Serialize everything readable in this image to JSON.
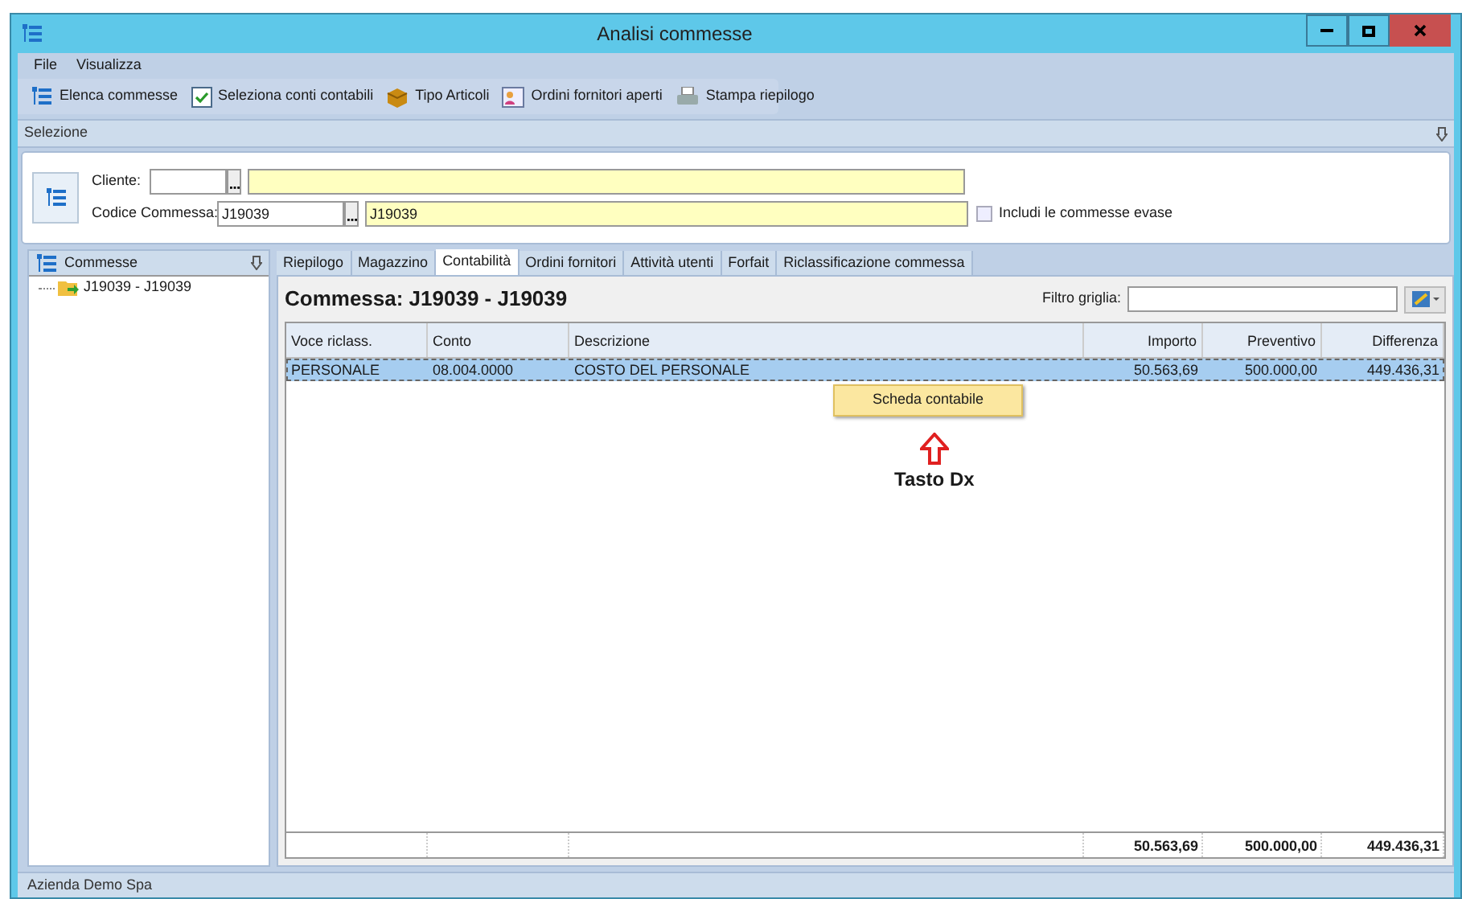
{
  "window": {
    "title": "Analisi commesse"
  },
  "menu": [
    "File",
    "Visualizza"
  ],
  "toolbar": [
    {
      "label": "Elenca commesse",
      "kind": "list"
    },
    {
      "label": "Seleziona conti contabili",
      "kind": "check"
    },
    {
      "label": "Tipo Articoli",
      "kind": "box"
    },
    {
      "label": "Ordini fornitori aperti",
      "kind": "person"
    },
    {
      "label": "Stampa riepilogo",
      "kind": "printer"
    }
  ],
  "selection": {
    "title": "Selezione",
    "cliente_label": "Cliente:",
    "codice_label": "Codice Commessa:",
    "codice_value": "J19039",
    "codice_desc": "J19039",
    "include_label": "Includi le commesse evase",
    "include_checked": false
  },
  "tree": {
    "title": "Commesse",
    "items": [
      {
        "label": "J19039 - J19039"
      }
    ]
  },
  "tabs": [
    {
      "label": "Riepilogo",
      "selected": false
    },
    {
      "label": "Magazzino",
      "selected": false
    },
    {
      "label": "Contabilità",
      "selected": true
    },
    {
      "label": "Ordini fornitori",
      "selected": false
    },
    {
      "label": "Attività utenti",
      "selected": false
    },
    {
      "label": "Forfait",
      "selected": false
    },
    {
      "label": "Riclassificazione commessa",
      "selected": false
    }
  ],
  "heading": "Commessa: J19039 - J19039",
  "filter_label": "Filtro griglia:",
  "table": {
    "columns": [
      "Voce riclass.",
      "Conto",
      "Descrizione",
      "Importo",
      "Preventivo",
      "Differenza"
    ],
    "rows": [
      {
        "cells": [
          "PERSONALE",
          "08.004.0000",
          "COSTO DEL PERSONALE",
          "50.563,69",
          "500.000,00",
          "449.436,31"
        ],
        "selected": true
      }
    ],
    "totals": [
      "50.563,69",
      "500.000,00",
      "449.436,31"
    ]
  },
  "context_menu": [
    "Scheda contabile"
  ],
  "annotation": "Tasto Dx",
  "status_bar": "Azienda Demo Spa"
}
